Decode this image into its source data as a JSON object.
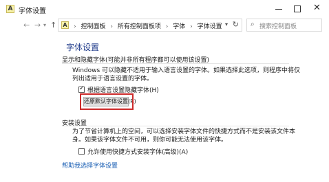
{
  "window": {
    "title": "字体设置",
    "app_icon_glyph": "A"
  },
  "address_bar": {
    "breadcrumbs": [
      "控制面板",
      "所有控制面板项",
      "字体",
      "字体设置"
    ],
    "search_placeholder": "搜索控制面板"
  },
  "content": {
    "page_title": "字体设置",
    "section1": {
      "title": "显示和隐藏字体(可能并非所有程序都可以使用该设置)",
      "description": "Windows 可以隐藏不适用于输入语言设置的字体。如果选择此选项，则程序中将仅列出适用于语言设置的字体。",
      "checkbox_label": "根据语言设置隐藏字体(H)",
      "checkbox_checked": true,
      "restore_button_label": "还原默认字体设置(R)"
    },
    "section2": {
      "title": "安装设置",
      "description": "为了节省计算机上的空间，可以选择安装字体文件的快捷方式而不是安装该文件本身。如果该字体文件不可用，则你可能无法使用该字体。",
      "checkbox_label": "允许使用快捷方式安装字体(高级)(A)",
      "checkbox_checked": false
    },
    "help_link": "帮助我选择字体设置"
  },
  "colors": {
    "highlight": "#cc2a2a",
    "page_title": "#1e3a8a",
    "link": "#1a5fb4"
  }
}
